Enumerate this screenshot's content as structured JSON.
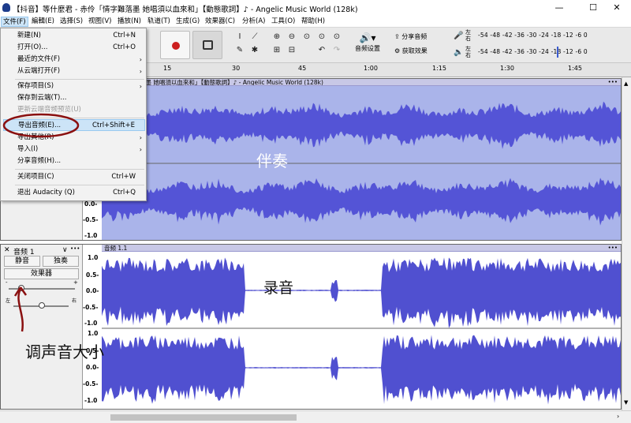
{
  "window": {
    "title": "【抖音】等什麼君 - 赤伶「情字難落墨 她唱須以血來和」【動態歌詞】♪ - Angelic Music World (128k)",
    "minimize": "—",
    "maximize": "☐",
    "close": "✕"
  },
  "menubar": {
    "items": [
      {
        "label": "文件(F)"
      },
      {
        "label": "編輯(E)"
      },
      {
        "label": "选择(S)"
      },
      {
        "label": "视图(V)"
      },
      {
        "label": "播放(N)"
      },
      {
        "label": "轨道(T)"
      },
      {
        "label": "生成(G)"
      },
      {
        "label": "效果器(C)"
      },
      {
        "label": "分析(A)"
      },
      {
        "label": "工具(O)"
      },
      {
        "label": "帮助(H)"
      }
    ]
  },
  "file_menu": {
    "items": [
      {
        "label": "新建(N)",
        "shortcut": "Ctrl+N"
      },
      {
        "label": "打开(O)...",
        "shortcut": "Ctrl+O"
      },
      {
        "label": "最近的文件(F)",
        "arrow": "›"
      },
      {
        "label": "从云端打开(F)",
        "arrow": "›"
      },
      {
        "label": "保存项目(S)",
        "arrow": "›"
      },
      {
        "label": "保存到云端(T)..."
      },
      {
        "label": "更新云端音频预览(U)"
      },
      {
        "label": "导出音频(E)...",
        "shortcut": "Ctrl+Shift+E"
      },
      {
        "label": "导出其他(R)",
        "arrow": "›"
      },
      {
        "label": "导入(I)",
        "arrow": "›"
      },
      {
        "label": "分享音频(H)..."
      },
      {
        "label": "关闭项目(C)",
        "shortcut": "Ctrl+W"
      },
      {
        "label": "退出 Audacity (Q)",
        "shortcut": "Ctrl+Q"
      }
    ]
  },
  "toolbar": {
    "share_audio": "分享音频",
    "get_effects": "获取效果",
    "audio_settings": "音频设置",
    "meter_left": "左",
    "meter_right": "右",
    "meter_scale": "-54  -48  -42  -36  -30  -24  -18  -12   -6    0",
    "meter_scale2": "-54  -48  -42  -36  -30  -24  -18  -12   -6    0"
  },
  "ruler": {
    "ticks": [
      "15",
      "30",
      "45",
      "1:00",
      "1:15",
      "1:30",
      "1:45"
    ]
  },
  "track1": {
    "clip_title": "赤伶「情字難落墨 她唱須以血來和」【動態歌詞】♪ - Angelic Music World (128k)",
    "menu_dots": "•••",
    "y_labels": [
      "0.0-",
      "-0.5-",
      "-1.0"
    ],
    "annotation": "伴奏"
  },
  "track2": {
    "name": "音频 1",
    "close": "✕",
    "collapse": "∨",
    "dots": "•••",
    "mute": "静音",
    "solo": "独奏",
    "effects": "效果器",
    "gain_minus": "-",
    "gain_plus": "+",
    "pan_left": "左",
    "pan_right": "右",
    "clip_title": "音频 1.1",
    "menu_dots": "•••",
    "y_labels": [
      "1.0",
      "0.5-",
      "0.0-",
      "-0.5-",
      "-1.0",
      "1.0",
      "0.5-",
      "0.0-",
      "-0.5-",
      "-1.0"
    ],
    "annotation": "录音"
  },
  "annotations": {
    "volume_note": "调声音大小"
  },
  "colors": {
    "wave": "#4c4ccc",
    "annotation_red": "#8a1010",
    "highlight": "#cce4f7"
  }
}
